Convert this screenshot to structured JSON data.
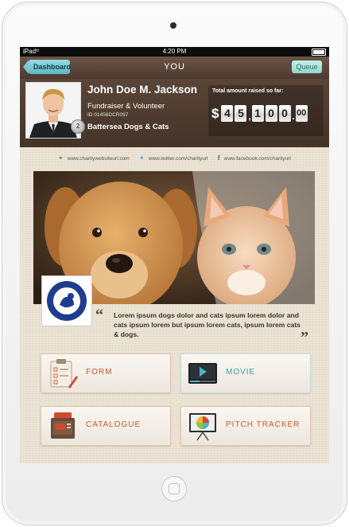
{
  "status_bar": {
    "carrier": "iPad",
    "time": "4:20 PM"
  },
  "nav": {
    "back_label": "Dashboard",
    "title": "YOU",
    "queue_label": "Queue"
  },
  "profile": {
    "name": "John Doe M. Jackson",
    "role": "Fundraiser & Volunteer",
    "id_text": "ID 01456DCR097",
    "organization": "Battersea Dogs & Cats",
    "badge_rank": "2"
  },
  "fundraising": {
    "label": "Total amount raised so far:",
    "currency": "$",
    "digits": [
      "4",
      "5",
      "1",
      "0",
      "0"
    ],
    "cents": "00"
  },
  "links": {
    "website": "www.charitywebsiteurl.com",
    "twitter": "www.twitter.com/charityurl",
    "facebook": "www.facebook.com/charityurl"
  },
  "quote": {
    "open": "“",
    "text": "Lorem ipsum dogs dolor and cats ipsum lorem dolor and cats ipsum  lorem but ipsum lorem cats, ipsum lorem cats & dogs.",
    "close": "”"
  },
  "tiles": [
    {
      "label": "FORM",
      "icon": "clipboard-form-icon"
    },
    {
      "label": "MOVIE",
      "icon": "video-player-icon"
    },
    {
      "label": "CATALOGUE",
      "icon": "catalogue-folder-icon"
    },
    {
      "label": "PITCH TRACKER",
      "icon": "presentation-chart-icon"
    }
  ],
  "colors": {
    "accent_teal": "#5fb7c6",
    "accent_orange": "#c85a2f",
    "header_brown": "#4d3a2f",
    "background": "#ece4d4"
  }
}
